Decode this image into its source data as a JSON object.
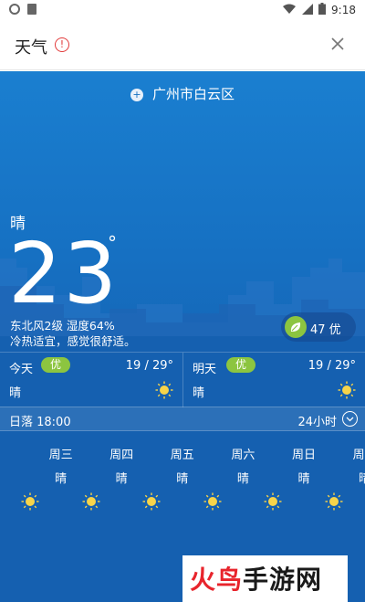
{
  "status_bar": {
    "time": "9:18"
  },
  "header": {
    "title": "天气",
    "warning_icon": "info-alert-icon",
    "close_icon": "close-icon"
  },
  "colors": {
    "sky_top": "#1a7fd0",
    "sky_bottom": "#135aa8",
    "aqi_good": "#8cc540",
    "sun": "#f7d44a",
    "alert": "#e23b3b"
  },
  "location": {
    "name": "广州市白云区",
    "icon": "location-icon"
  },
  "current": {
    "condition": "晴",
    "temperature": "23",
    "degree_symbol": "°",
    "wind_humidity": "东北风2级 湿度64%",
    "feel": "冷热适宜，感觉很舒适。"
  },
  "aqi": {
    "value": "47 优",
    "icon": "leaf-icon"
  },
  "days": [
    {
      "name": "今天",
      "quality": "优",
      "range": "19 / 29°",
      "condition": "晴",
      "icon": "sun-icon"
    },
    {
      "name": "明天",
      "quality": "优",
      "range": "19 / 29°",
      "condition": "晴",
      "icon": "sun-icon"
    }
  ],
  "sunset": {
    "label": "日落 18:00",
    "hourly_label": "24小时",
    "toggle_icon": "chevron-down-icon"
  },
  "forecast": [
    {
      "day": "周三",
      "condition": "晴",
      "icon": "sun-icon"
    },
    {
      "day": "周四",
      "condition": "晴",
      "icon": "sun-icon"
    },
    {
      "day": "周五",
      "condition": "晴",
      "icon": "sun-icon"
    },
    {
      "day": "周六",
      "condition": "晴",
      "icon": "sun-icon"
    },
    {
      "day": "周日",
      "condition": "晴",
      "icon": "sun-icon"
    },
    {
      "day": "周一",
      "condition": "晴",
      "icon": "sun-icon"
    }
  ],
  "watermark": {
    "part1": "火鸟",
    "part2": "手游网"
  }
}
